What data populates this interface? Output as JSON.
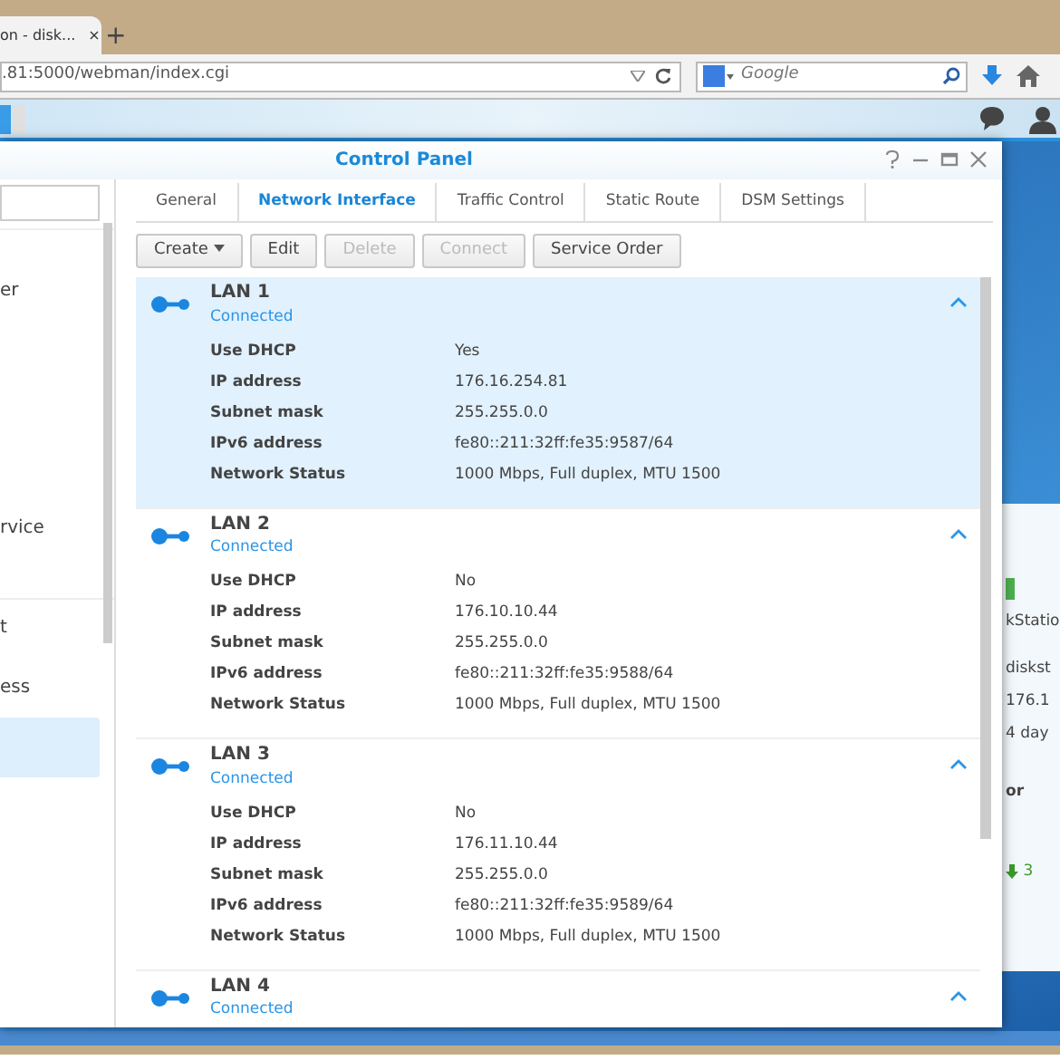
{
  "browser": {
    "tab": {
      "title": "on - disk...",
      "close": "×"
    },
    "new_tab": "+",
    "url": ".81:5000/webman/index.cgi",
    "search": {
      "placeholder": "Google"
    }
  },
  "window": {
    "title": "Control Panel"
  },
  "sidebar": {
    "items": [
      {
        "label": "er",
        "selected": false
      },
      {
        "label": "rvice",
        "selected": false
      },
      {
        "label": "t",
        "selected": false
      },
      {
        "label": "ess",
        "selected": false
      },
      {
        "selected": true
      }
    ]
  },
  "tabs": [
    {
      "label": "General",
      "selected": false
    },
    {
      "label": "Network Interface",
      "selected": true
    },
    {
      "label": "Traffic Control",
      "selected": false
    },
    {
      "label": "Static Route",
      "selected": false
    },
    {
      "label": "DSM Settings",
      "selected": false
    }
  ],
  "toolbar": [
    {
      "label": "Create",
      "kind": "dropdown",
      "disabled": false
    },
    {
      "label": "Edit",
      "kind": "plain",
      "disabled": false
    },
    {
      "label": "Delete",
      "kind": "plain",
      "disabled": true
    },
    {
      "label": "Connect",
      "kind": "plain",
      "disabled": true
    },
    {
      "label": "Service Order",
      "kind": "plain",
      "disabled": false
    }
  ],
  "interfaces": [
    {
      "name": "LAN 1",
      "status": "Connected",
      "selected": true,
      "expanded": true,
      "details": [
        {
          "label": "Use DHCP",
          "value": "Yes"
        },
        {
          "label": "IP address",
          "value": "176.16.254.81"
        },
        {
          "label": "Subnet mask",
          "value": "255.255.0.0"
        },
        {
          "label": "IPv6 address",
          "value": "fe80::211:32ff:fe35:9587/64"
        },
        {
          "label": "Network Status",
          "value": "1000 Mbps, Full duplex, MTU 1500"
        }
      ]
    },
    {
      "name": "LAN 2",
      "status": "Connected",
      "selected": false,
      "expanded": true,
      "details": [
        {
          "label": "Use DHCP",
          "value": "No"
        },
        {
          "label": "IP address",
          "value": "176.10.10.44"
        },
        {
          "label": "Subnet mask",
          "value": "255.255.0.0"
        },
        {
          "label": "IPv6 address",
          "value": "fe80::211:32ff:fe35:9588/64"
        },
        {
          "label": "Network Status",
          "value": "1000 Mbps, Full duplex, MTU 1500"
        }
      ]
    },
    {
      "name": "LAN 3",
      "status": "Connected",
      "selected": false,
      "expanded": true,
      "details": [
        {
          "label": "Use DHCP",
          "value": "No"
        },
        {
          "label": "IP address",
          "value": "176.11.10.44"
        },
        {
          "label": "Subnet mask",
          "value": "255.255.0.0"
        },
        {
          "label": "IPv6 address",
          "value": "fe80::211:32ff:fe35:9589/64"
        },
        {
          "label": "Network Status",
          "value": "1000 Mbps, Full duplex, MTU 1500"
        }
      ]
    },
    {
      "name": "LAN 4",
      "status": "Connected",
      "selected": false,
      "expanded": true
    }
  ],
  "background_window": {
    "texts": [
      "kStatio",
      "diskst",
      "176.1",
      "4 day"
    ],
    "heading": "or",
    "traffic": "3"
  }
}
